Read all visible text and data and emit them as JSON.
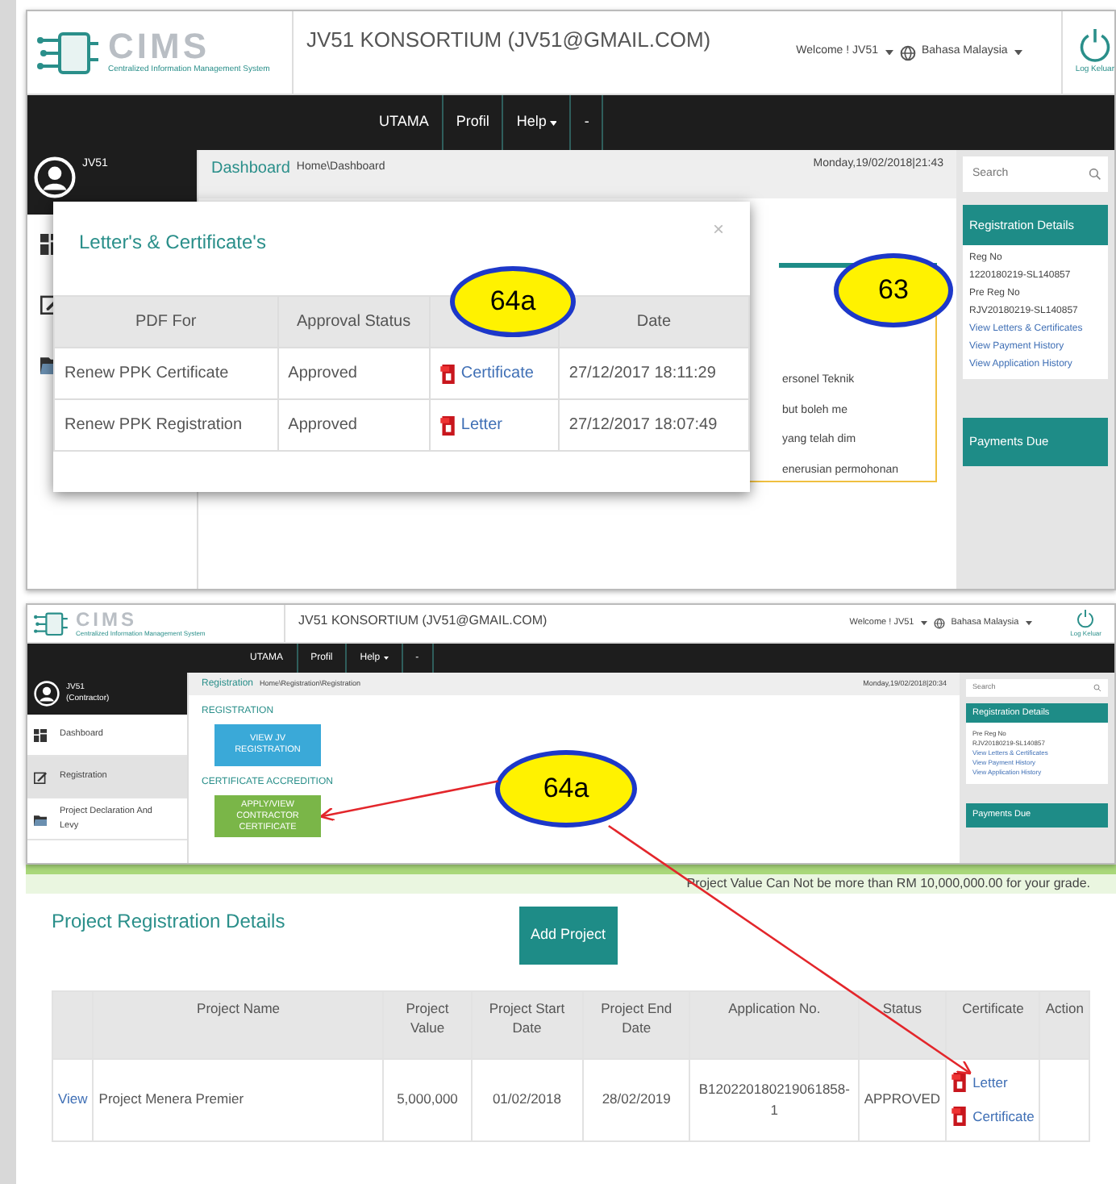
{
  "screen_1": {
    "header": {
      "logo_title": "CIMS",
      "logo_subtitle": "Centralized Information Management System",
      "account": "JV51 KONSORTIUM (JV51@GMAIL.COM)",
      "welcome": "Welcome ! JV51",
      "language": "Bahasa Malaysia",
      "logout": "Log Keluar"
    },
    "nav": [
      {
        "label": "UTAMA",
        "dropdown": false
      },
      {
        "label": "Profil",
        "dropdown": false
      },
      {
        "label": "Help",
        "dropdown": true
      },
      {
        "label": "-",
        "dropdown": false
      }
    ],
    "user": "JV51",
    "breadcrumb": {
      "title": "Dashboard",
      "path": "Home\\Dashboard"
    },
    "datetime": "Monday,19/02/2018|21:43",
    "search": {
      "placeholder": "Search"
    },
    "registration_details": {
      "title": "Registration Details",
      "lines": [
        "Reg No",
        "1220180219-SL140857",
        "Pre Reg No",
        "RJV20180219-SL140857"
      ],
      "links": [
        "View Letters & Certificates",
        "View Payment History",
        "View Application History"
      ]
    },
    "payments_due": "Payments Due",
    "background_text": [
      "ersonel Teknik",
      "but boleh me",
      "yang telah dim",
      "enerusian permohonan"
    ],
    "modal": {
      "title": "Letter's & Certificate's",
      "close": "×",
      "columns": [
        "PDF For",
        "Approval Status",
        "Date"
      ],
      "rows": [
        {
          "pdf_for": "Renew PPK Certificate",
          "status": "Approved",
          "document": "Certificate",
          "date": "27/12/2017 18:11:29"
        },
        {
          "pdf_for": "Renew PPK Registration",
          "status": "Approved",
          "document": "Letter",
          "date": "27/12/2017 18:07:49"
        }
      ]
    },
    "callouts": [
      "64a",
      "63"
    ]
  },
  "screen_2": {
    "header": {
      "logo_title": "CIMS",
      "logo_subtitle": "Centralized Information Management System",
      "account": "JV51 KONSORTIUM (JV51@GMAIL.COM)",
      "welcome": "Welcome ! JV51",
      "language": "Bahasa Malaysia",
      "logout": "Log Keluar"
    },
    "nav": [
      {
        "label": "UTAMA",
        "dropdown": false
      },
      {
        "label": "Profil",
        "dropdown": false
      },
      {
        "label": "Help",
        "dropdown": true
      },
      {
        "label": "-",
        "dropdown": false
      }
    ],
    "user": "JV51",
    "role": "(Contractor)",
    "sidebar": [
      {
        "label": "Dashboard",
        "selected": false,
        "kind": "dashboard"
      },
      {
        "label": "Registration",
        "selected": true,
        "kind": "edit"
      },
      {
        "label": "Project Declaration And Levy",
        "selected": false,
        "kind": "folder"
      }
    ],
    "breadcrumb": {
      "title": "Registration",
      "path": "Home\\Registration\\Registration"
    },
    "datetime": "Monday,19/02/2018|20:34",
    "sections": [
      {
        "title": "REGISTRATION",
        "button": "VIEW JV REGISTRATION",
        "color": "#3aa9d8"
      },
      {
        "title": "CERTIFICATE ACCREDITION",
        "button": "APPLY/VIEW CONTRACTOR CERTIFICATE",
        "color": "#7ab648"
      }
    ],
    "search": {
      "placeholder": "Search"
    },
    "registration_details": {
      "title": "Registration Details",
      "lines": [
        "Pre Reg No",
        "RJV20180219-SL140857"
      ],
      "links": [
        "View Letters & Certificates",
        "View Payment History",
        "View Application History"
      ]
    },
    "payments_due": "Payments Due",
    "callout": "64a"
  },
  "screen_3": {
    "notice": "Project Value Can Not be more than RM 10,000,000.00 for your grade.",
    "title": "Project Registration Details",
    "add_button": "Add Project",
    "columns": [
      "Project Name",
      "Project Value",
      "Project Start Date",
      "Project End Date",
      "Application No.",
      "Status",
      "Certificate",
      "Action"
    ],
    "rows": [
      {
        "link": "View",
        "project_name": "Project Menera Premier",
        "value": "5,000,000",
        "start": "01/02/2018",
        "end": "28/02/2019",
        "application": "B120220180219061858-1",
        "status": "APPROVED",
        "certificates": [
          "Letter",
          "Certificate"
        ]
      }
    ]
  }
}
